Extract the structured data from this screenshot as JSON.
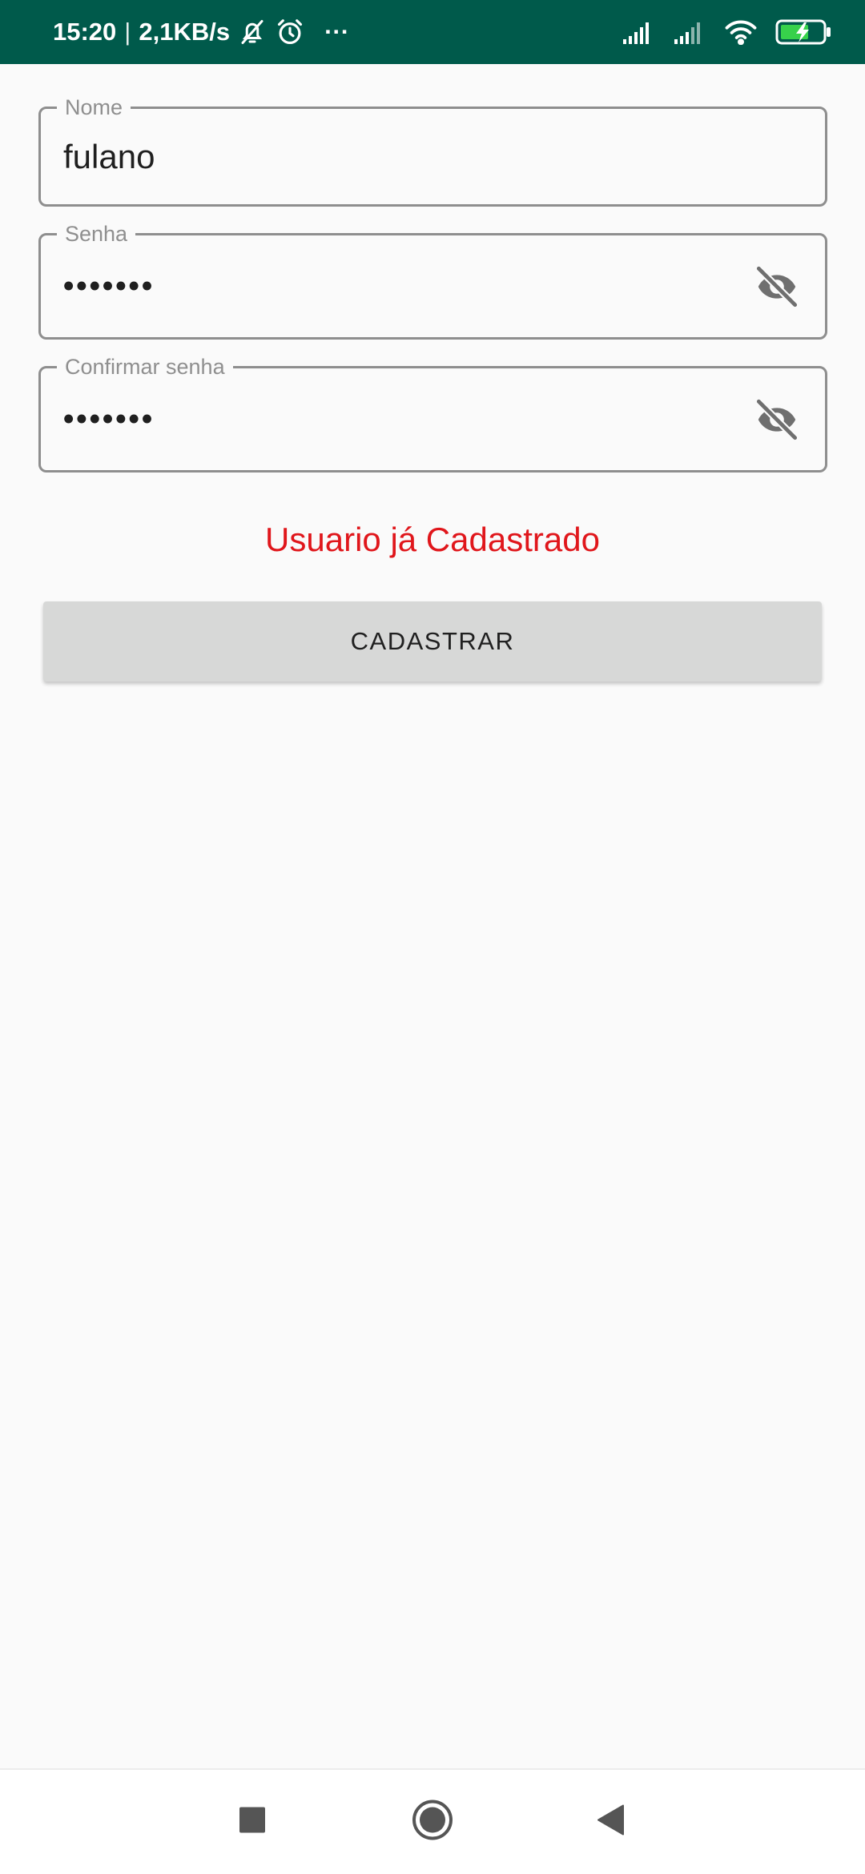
{
  "status_bar": {
    "time": "15:20",
    "separator": "|",
    "network_speed": "2,1KB/s",
    "more": "···",
    "background_color": "#005a4b"
  },
  "form": {
    "name_field": {
      "label": "Nome",
      "value": "fulano"
    },
    "password_field": {
      "label": "Senha",
      "value": "•••••••"
    },
    "confirm_field": {
      "label": "Confirmar senha",
      "value": "•••••••"
    }
  },
  "error_message": "Usuario já Cadastrado",
  "error_color": "#e0161b",
  "register_button": "CADASTRAR",
  "icons": {
    "status": [
      "notifications-off-icon",
      "alarm-icon",
      "signal-icon",
      "signal-icon",
      "wifi-icon",
      "battery-charging-icon"
    ],
    "fields": [
      "visibility-off-icon"
    ],
    "nav": [
      "recents-square-icon",
      "home-circle-icon",
      "back-triangle-icon"
    ]
  }
}
